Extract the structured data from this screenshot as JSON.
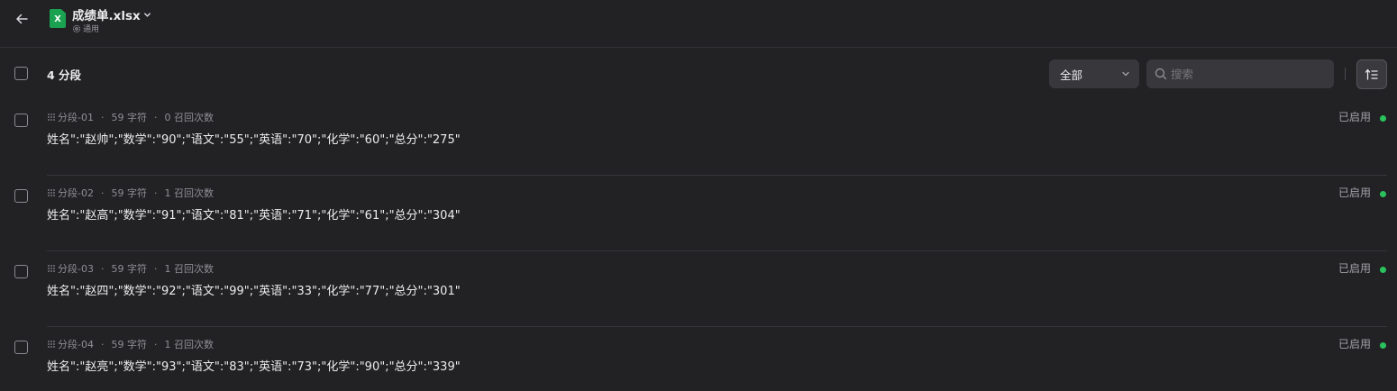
{
  "header": {
    "back_icon": "arrow-left-icon",
    "file_icon_label": "X",
    "file_name": "成绩单.xlsx",
    "file_mode": "通用"
  },
  "toolbar": {
    "segment_count": "4 分段",
    "filter_selected": "全部",
    "search_placeholder": "搜索",
    "search_value": ""
  },
  "segments": [
    {
      "id": "分段-01",
      "chars": "59 字符",
      "recalls": "0 召回次数",
      "content": "姓名\":\"赵帅\";\"数学\":\"90\";\"语文\":\"55\";\"英语\":\"70\";\"化学\":\"60\";\"总分\":\"275\"",
      "status": "已启用"
    },
    {
      "id": "分段-02",
      "chars": "59 字符",
      "recalls": "1 召回次数",
      "content": "姓名\":\"赵高\";\"数学\":\"91\";\"语文\":\"81\";\"英语\":\"71\";\"化学\":\"61\";\"总分\":\"304\"",
      "status": "已启用"
    },
    {
      "id": "分段-03",
      "chars": "59 字符",
      "recalls": "1 召回次数",
      "content": "姓名\":\"赵四\";\"数学\":\"92\";\"语文\":\"99\";\"英语\":\"33\";\"化学\":\"77\";\"总分\":\"301\"",
      "status": "已启用"
    },
    {
      "id": "分段-04",
      "chars": "59 字符",
      "recalls": "1 召回次数",
      "content": "姓名\":\"赵亮\";\"数学\":\"93\";\"语文\":\"83\";\"英语\":\"73\";\"化学\":\"90\";\"总分\":\"339\"",
      "status": "已启用"
    }
  ],
  "colors": {
    "background": "#222225",
    "excel_green": "#1aa251",
    "status_enabled": "#29c25d"
  }
}
